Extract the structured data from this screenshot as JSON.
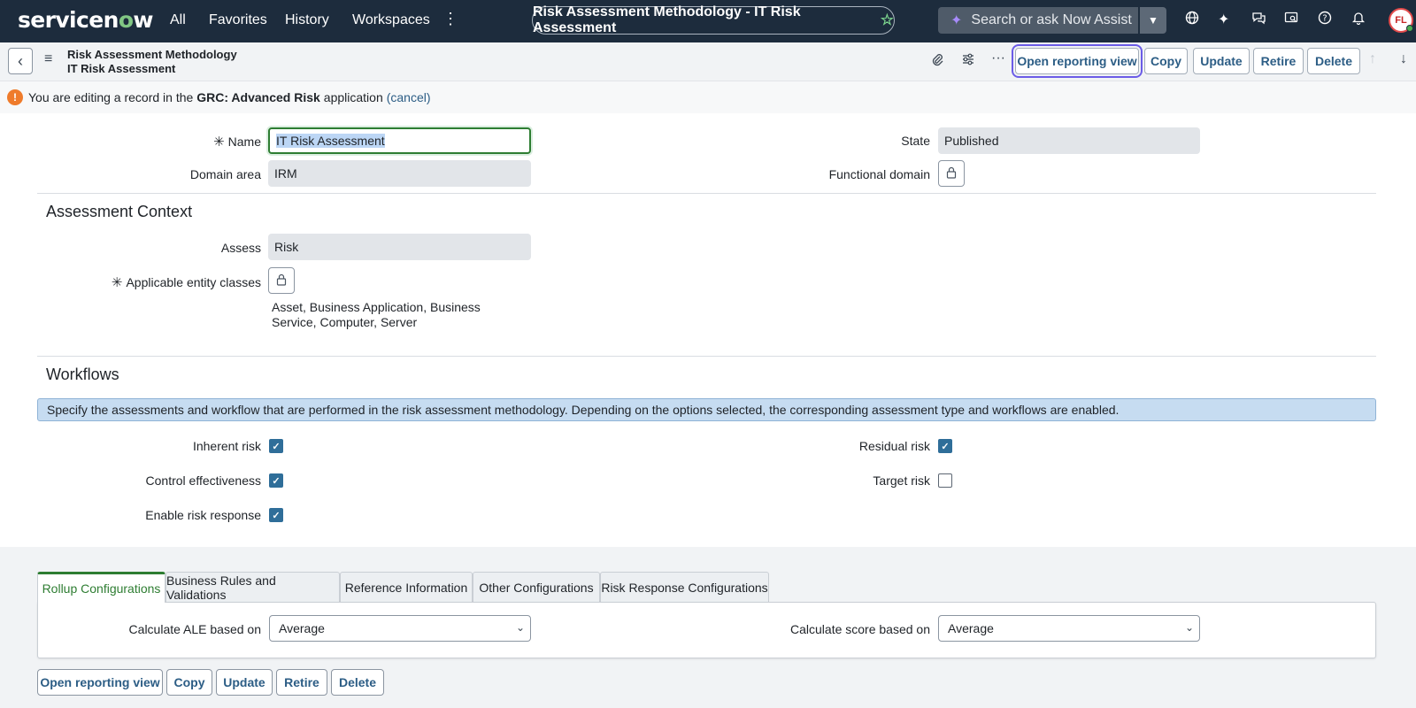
{
  "topnav": {
    "logo": "servicenow",
    "links": [
      "All",
      "Favorites",
      "History",
      "Workspaces"
    ],
    "more_icon": "vertical-ellipsis-icon",
    "record_title": "Risk Assessment Methodology - IT Risk Assessment",
    "search_placeholder": "Search or ask Now Assist",
    "icons": [
      "globe-icon",
      "sparkle-icon",
      "chat-icon",
      "screen-search-icon",
      "help-icon",
      "bell-icon"
    ],
    "avatar_initials": "FL"
  },
  "form_header": {
    "breadcrumb_line1": "Risk Assessment Methodology",
    "breadcrumb_line2": "IT Risk Assessment",
    "buttons": {
      "open_reporting": "Open reporting view",
      "copy": "Copy",
      "update": "Update",
      "retire": "Retire",
      "delete": "Delete"
    }
  },
  "info_banner": {
    "prefix": "You are editing a record in the",
    "app": "GRC: Advanced Risk",
    "suffix": "application",
    "cancel": "(cancel)"
  },
  "fields": {
    "name_label": "Name",
    "name_value": "IT Risk Assessment",
    "domain_area_label": "Domain area",
    "domain_area_value": "IRM",
    "state_label": "State",
    "state_value": "Published",
    "functional_domain_label": "Functional domain"
  },
  "assessment_context": {
    "title": "Assessment Context",
    "assess_label": "Assess",
    "assess_value": "Risk",
    "entity_classes_label": "Applicable entity classes",
    "entity_classes_value": "Asset, Business Application, Business Service, Computer, Server"
  },
  "workflows": {
    "title": "Workflows",
    "note": "Specify the assessments and workflow that are performed in the risk assessment methodology. Depending on the options selected, the corresponding assessment type and workflows are enabled.",
    "inherent_risk": "Inherent risk",
    "control_effectiveness": "Control effectiveness",
    "enable_risk_response": "Enable risk response",
    "residual_risk": "Residual risk",
    "target_risk": "Target risk",
    "checked": {
      "inherent_risk": true,
      "control_effectiveness": true,
      "enable_risk_response": true,
      "residual_risk": true,
      "target_risk": false
    }
  },
  "tabs": [
    "Rollup Configurations",
    "Business Rules and Validations",
    "Reference Information",
    "Other Configurations",
    "Risk Response Configurations"
  ],
  "rollup": {
    "ale_label": "Calculate ALE based on",
    "ale_value": "Average",
    "score_label": "Calculate score based on",
    "score_value": "Average"
  },
  "colors": {
    "nav_bg": "#1d2c3d",
    "accent_green": "#2e7d32",
    "button_text": "#2c5d85",
    "focus_outline": "#6b5ce7",
    "checkbox": "#2f6e99"
  }
}
